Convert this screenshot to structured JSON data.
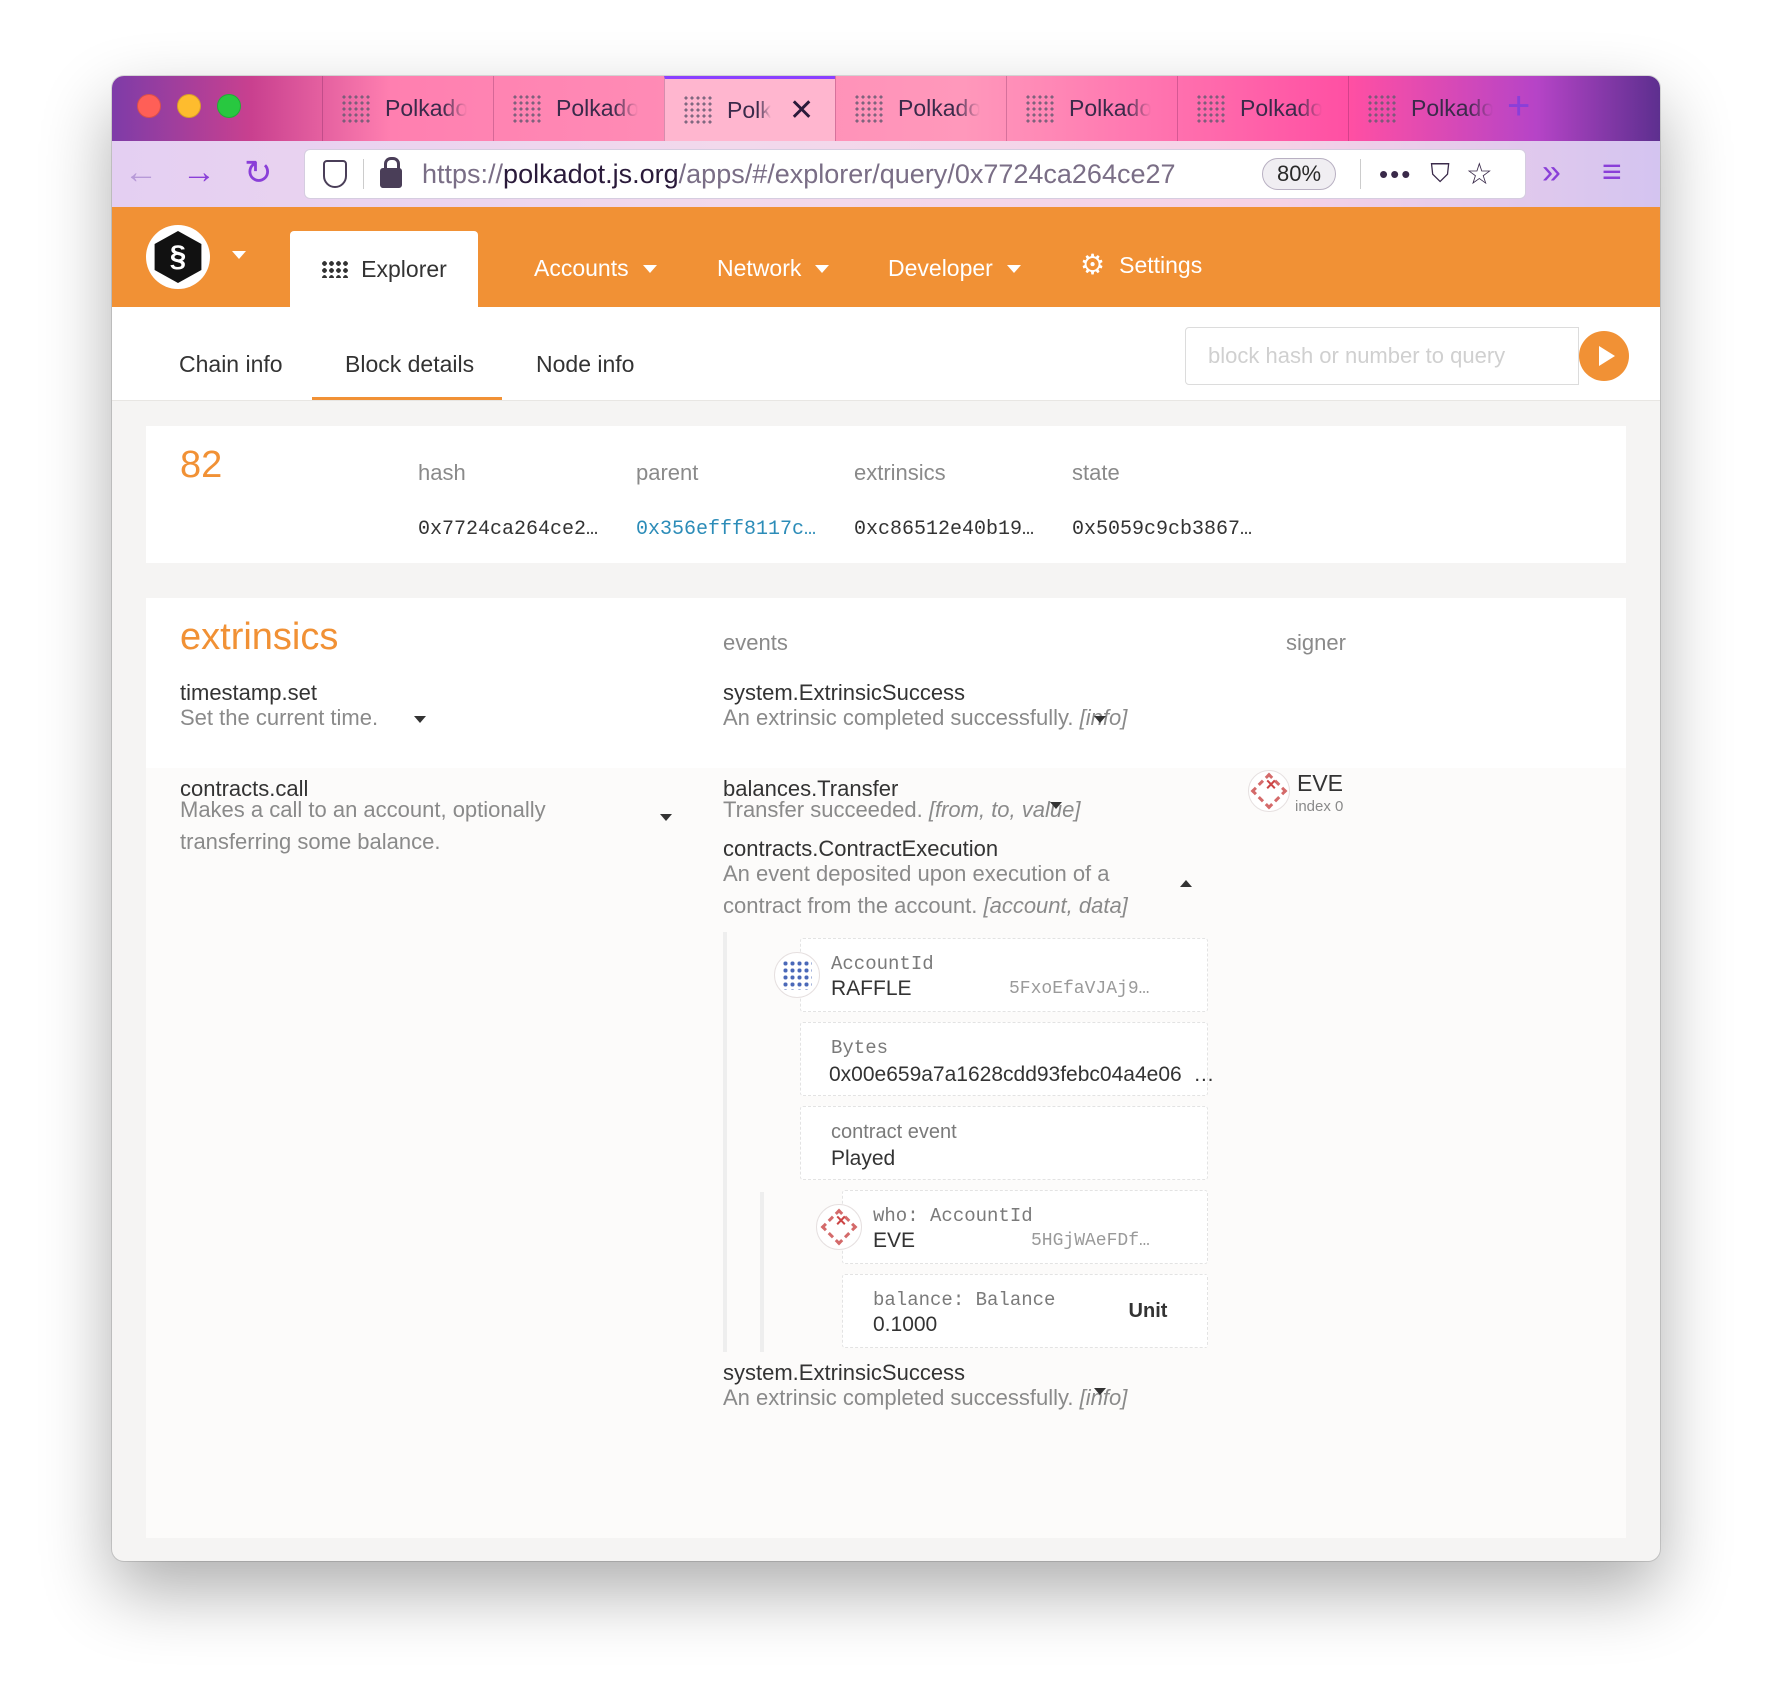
{
  "browser": {
    "tabs": [
      {
        "label": "Polkadot"
      },
      {
        "label": "Polkadot"
      },
      {
        "label": "Polkadot"
      },
      {
        "label": "Polkadot"
      },
      {
        "label": "Polkadot"
      },
      {
        "label": "Polkadot"
      },
      {
        "label": "Polkadot"
      }
    ],
    "active_tab_index": 2,
    "url_prefix": "https://",
    "url_host": "polkadot.js.org",
    "url_path": "/apps/#/explorer/query/0x7724ca264ce27",
    "zoom": "80%"
  },
  "app": {
    "menu": {
      "explorer": "Explorer",
      "accounts": "Accounts",
      "network": "Network",
      "developer": "Developer",
      "settings": "Settings"
    },
    "subtabs": {
      "chain_info": "Chain info",
      "block_details": "Block details",
      "node_info": "Node info"
    },
    "query_placeholder": "block hash or number to query"
  },
  "block": {
    "number": "82",
    "hash_label": "hash",
    "parent_label": "parent",
    "extrinsics_label": "extrinsics",
    "state_label": "state",
    "hash": "0x7724ca264ce2…",
    "parent": "0x356efff8117c…",
    "extrinsics": "0xc86512e40b19…",
    "state": "0x5059c9cb3867…"
  },
  "extrinsics": {
    "title": "extrinsics",
    "events_header": "events",
    "signer_header": "signer",
    "rows": [
      {
        "name": "timestamp.set",
        "desc": "Set the current time.",
        "events": [
          {
            "name": "system.ExtrinsicSuccess",
            "desc": "An extrinsic completed successfully.",
            "args": "[info]"
          }
        ]
      },
      {
        "name": "contracts.call",
        "desc": "Makes a call to an account, optionally transferring some balance.",
        "signer": {
          "name": "EVE",
          "index": "index 0"
        },
        "events": [
          {
            "name": "balances.Transfer",
            "desc": "Transfer succeeded.",
            "args": "[from, to, value]"
          },
          {
            "name": "contracts.ContractExecution",
            "desc": "An event deposited upon execution of a contract from the account.",
            "args": "[account, data]"
          },
          {
            "name": "system.ExtrinsicSuccess",
            "desc": "An extrinsic completed successfully.",
            "args": "[info]"
          }
        ],
        "contract_params": {
          "account": {
            "label": "AccountId",
            "name": "RAFFLE",
            "address": "5FxoEfaVJAj9…"
          },
          "bytes": {
            "label": "Bytes",
            "value": "0x00e659a7a1628cdd93febc04a4e06",
            "ellipsis": "…"
          },
          "contract_event": {
            "label": "contract event",
            "value": "Played"
          },
          "who": {
            "label": "who: AccountId",
            "name": "EVE",
            "address": "5HGjWAeFDf…"
          },
          "balance": {
            "label": "balance: Balance",
            "value": "0.1000",
            "unit": "Unit"
          }
        }
      }
    ]
  }
}
